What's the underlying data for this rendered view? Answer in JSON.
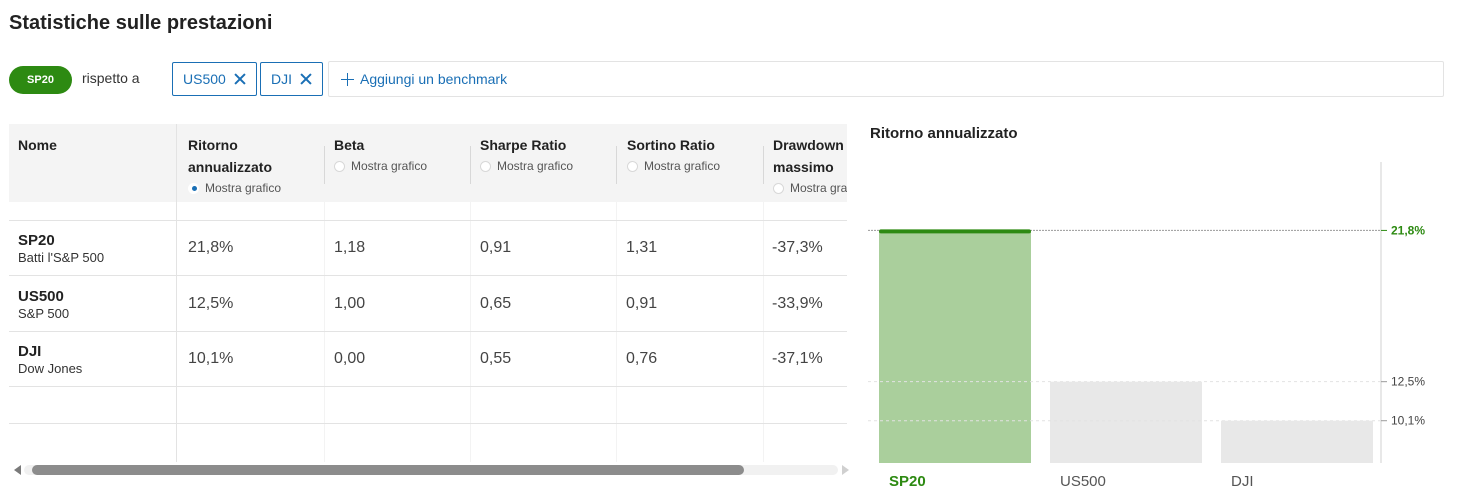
{
  "title": "Statistiche sulle prestazioni",
  "benchmark_bar": {
    "primary": "SP20",
    "compare_label": "rispetto a",
    "chips": [
      "US500",
      "DJI"
    ],
    "add_label": "Aggiungi un benchmark"
  },
  "table": {
    "columns": [
      {
        "label": "Nome"
      },
      {
        "label": "Ritorno annualizzato",
        "label_l1": "Ritorno",
        "label_l2": "annualizzato",
        "radio": "Mostra grafico",
        "selected": true
      },
      {
        "label": "Beta",
        "radio": "Mostra grafico",
        "selected": false
      },
      {
        "label": "Sharpe Ratio",
        "radio": "Mostra grafico",
        "selected": false
      },
      {
        "label": "Sortino Ratio",
        "radio": "Mostra grafico",
        "selected": false
      },
      {
        "label": "Drawdown massimo",
        "label_l1": "Drawdown",
        "label_l2": "massimo",
        "radio": "Mostra grafico",
        "selected": false
      }
    ],
    "rows": [
      {
        "symbol": "SP20",
        "name": "Batti l'S&P 500",
        "values": [
          "21,8%",
          "1,18",
          "0,91",
          "1,31",
          "-37,3%"
        ]
      },
      {
        "symbol": "US500",
        "name": "S&P 500",
        "values": [
          "12,5%",
          "1,00",
          "0,65",
          "0,91",
          "-33,9%"
        ]
      },
      {
        "symbol": "DJI",
        "name": "Dow Jones",
        "values": [
          "10,1%",
          "0,00",
          "0,55",
          "0,76",
          "-37,1%"
        ]
      }
    ]
  },
  "chart": {
    "title": "Ritorno annualizzato",
    "colors": {
      "highlight_fill": "#aacf9c",
      "highlight_top": "#2d8a12",
      "highlight_label": "#2d8a12",
      "other_fill": "#e8e8e8"
    }
  },
  "chart_data": {
    "type": "bar",
    "title": "Ritorno annualizzato",
    "categories": [
      "SP20",
      "US500",
      "DJI"
    ],
    "values": [
      21.8,
      12.5,
      10.1
    ],
    "value_labels": [
      "21,8%",
      "12,5%",
      "10,1%"
    ],
    "highlight": "SP20",
    "ylim": [
      7.5,
      24.9
    ],
    "grid": false,
    "legend": "none"
  }
}
